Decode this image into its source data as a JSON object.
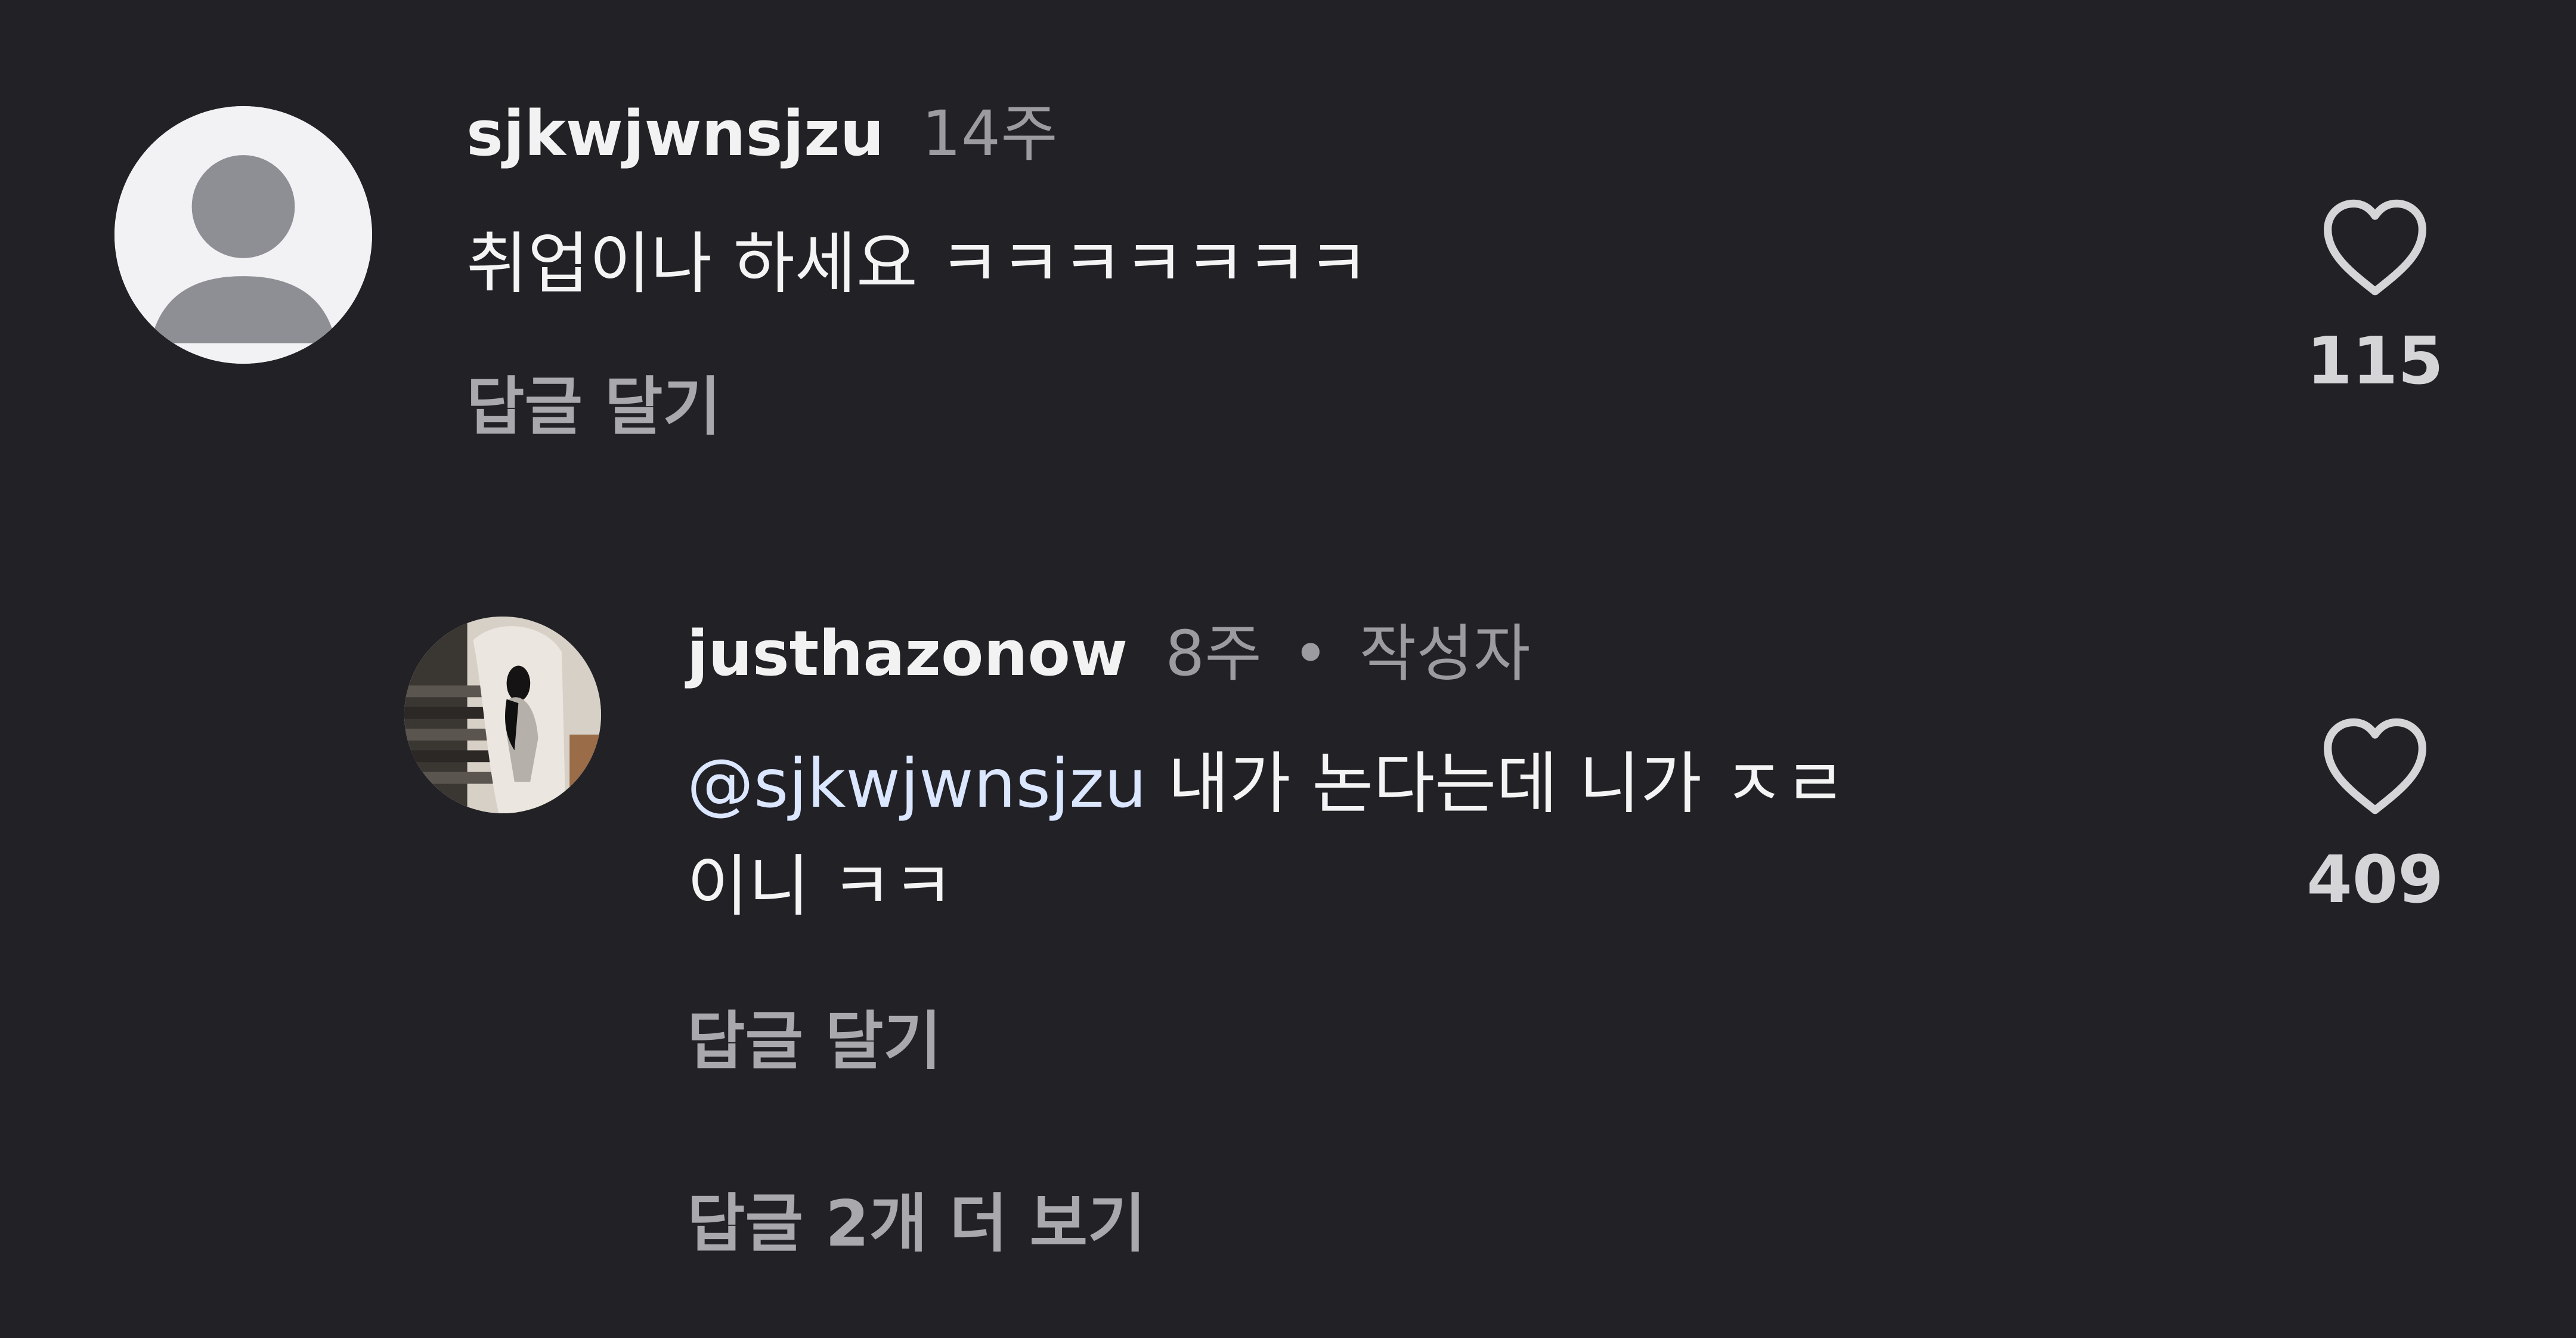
{
  "comments": [
    {
      "username": "sjkwjwnsjzu",
      "time": "14주",
      "text": "취업이나 하세요 ㅋㅋㅋㅋㅋㅋㅋ",
      "reply_label": "답글 달기",
      "likes": "115",
      "avatar_icon": "default-user-avatar"
    },
    {
      "username": "justhazonow",
      "time": "8주",
      "dot": "•",
      "author_tag": "작성자",
      "mention": "@sjkwjwnsjzu",
      "text_line1": " 내가 논다는데 니가 ㅈㄹ",
      "text_line2": "이니 ㅋㅋ",
      "reply_label": "답글 달기",
      "likes": "409",
      "avatar_icon": "user-photo-avatar"
    }
  ],
  "more_replies_label": "답글 2개 더 보기",
  "icons": {
    "like": "heart-outline-icon"
  },
  "colors": {
    "background": "#212126",
    "mention": "#dbe6ff",
    "muted": "#a9a9ad"
  }
}
